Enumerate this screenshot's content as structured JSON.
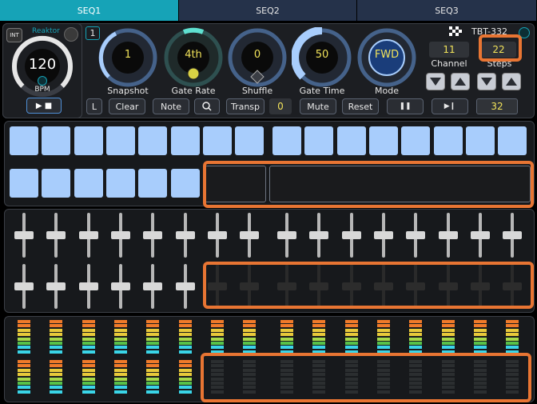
{
  "tabs": [
    {
      "label": "SEQ1",
      "active": true
    },
    {
      "label": "SEQ2",
      "active": false
    },
    {
      "label": "SEQ3",
      "active": false
    }
  ],
  "clock": {
    "int_label": "INT",
    "brand": "Reaktor",
    "bpm_value": "120",
    "bpm_label": "BPM",
    "play_stop": "▶ ■"
  },
  "header": {
    "seq_number": "1",
    "device_name": "TBT-332"
  },
  "knobs": [
    {
      "label": "Snapshot",
      "value": "1"
    },
    {
      "label": "Gate Rate",
      "value": "4th"
    },
    {
      "label": "Shuffle",
      "value": "0"
    },
    {
      "label": "Gate Time",
      "value": "50"
    },
    {
      "label": "Mode",
      "value": "FWD"
    }
  ],
  "channel": {
    "label": "Channel",
    "value": "11"
  },
  "steps": {
    "label": "Steps",
    "value": "22"
  },
  "toolbar": {
    "l": "L",
    "clear": "Clear",
    "note": "Note",
    "transp": "Transp",
    "transp_value": "0",
    "mute": "Mute",
    "reset": "Reset",
    "pause": "❚❚",
    "step_fwd": "▶❙",
    "count": "32"
  },
  "colors": {
    "accent": "#16a3b7",
    "pad": "#a8cdfc",
    "value_text": "#f2e35a",
    "highlight": "#e87533"
  }
}
